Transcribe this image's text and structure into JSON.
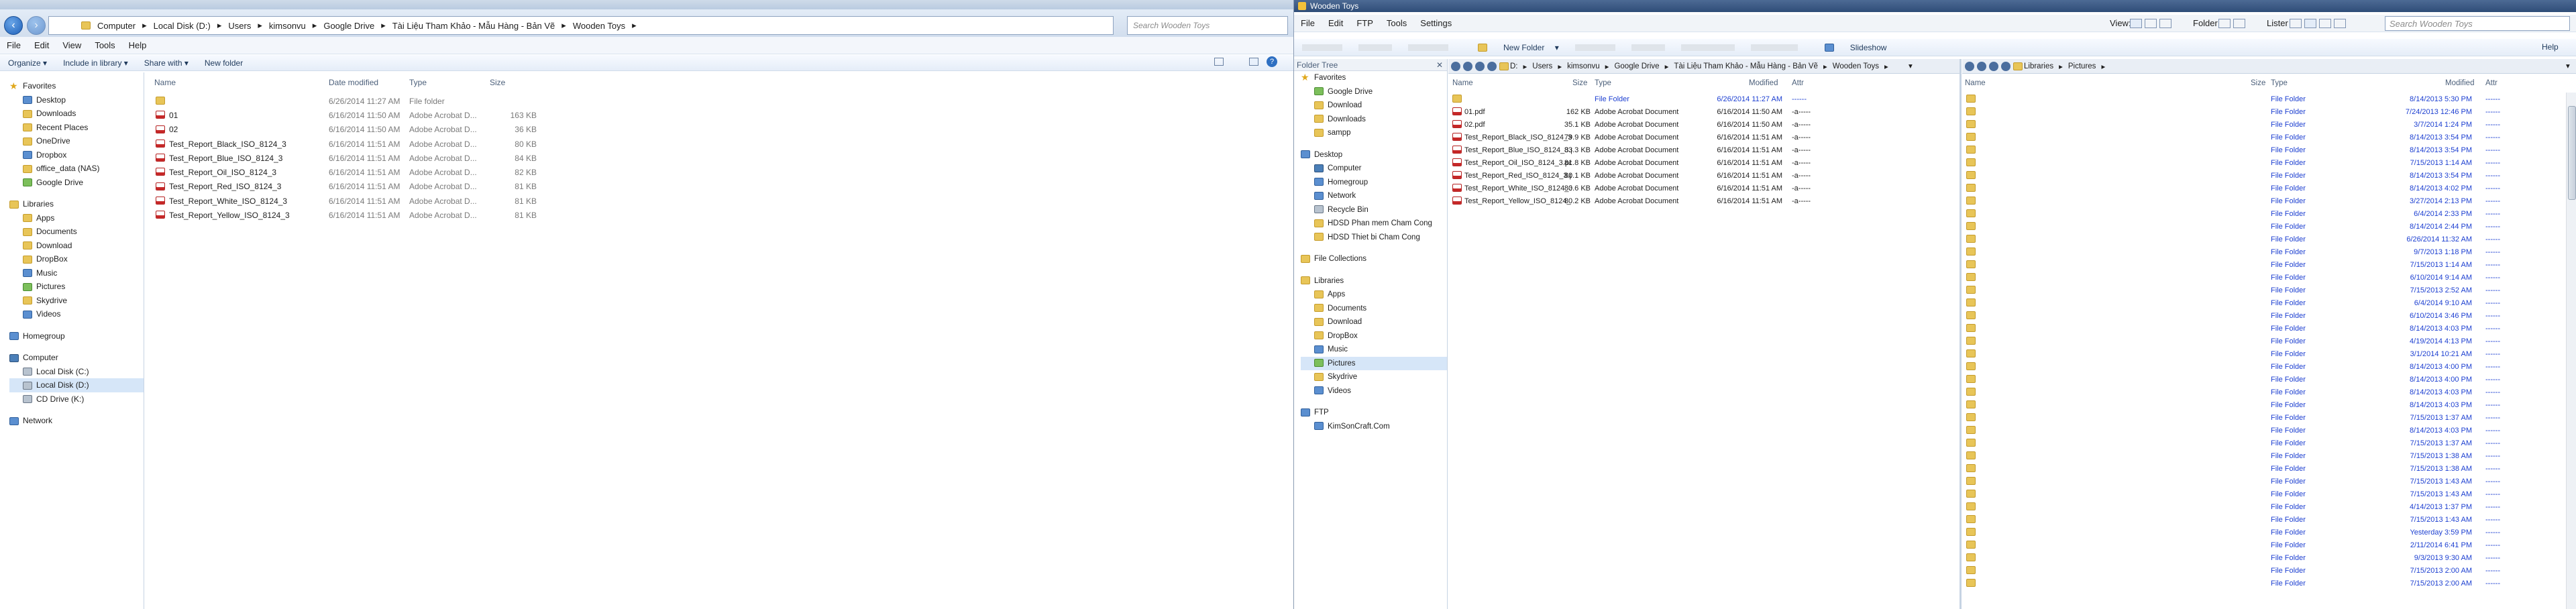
{
  "explorer": {
    "address": [
      "Computer",
      "Local Disk (D:)",
      "Users",
      "kimsonvu",
      "Google Drive",
      "Tài Liệu Tham Khảo - Mẫu Hàng - Bản Vẽ",
      "Wooden Toys"
    ],
    "search_placeholder": "Search Wooden Toys",
    "menu": [
      "File",
      "Edit",
      "View",
      "Tools",
      "Help"
    ],
    "commands": [
      "Organize ▾",
      "Include in library ▾",
      "Share with ▾",
      "New folder"
    ],
    "nav": {
      "favorites_label": "Favorites",
      "favorites": [
        "Desktop",
        "Downloads",
        "Recent Places",
        "OneDrive",
        "Dropbox",
        "office_data (NAS)",
        "Google Drive"
      ],
      "libraries_label": "Libraries",
      "libraries": [
        "Apps",
        "Documents",
        "Download",
        "DropBox",
        "Music",
        "Pictures",
        "Skydrive",
        "Videos"
      ],
      "homegroup": "Homegroup",
      "computer_label": "Computer",
      "drives": [
        "Local Disk (C:)",
        "Local Disk (D:)",
        "CD Drive (K:)"
      ],
      "network": "Network"
    },
    "columns": [
      "Name",
      "Date modified",
      "Type",
      "Size"
    ],
    "files": [
      {
        "name": "",
        "date": "6/26/2014 11:27 AM",
        "type": "File folder",
        "size": ""
      },
      {
        "name": "01",
        "date": "6/16/2014 11:50 AM",
        "type": "Adobe Acrobat D...",
        "size": "163 KB"
      },
      {
        "name": "02",
        "date": "6/16/2014 11:50 AM",
        "type": "Adobe Acrobat D...",
        "size": "36 KB"
      },
      {
        "name": "Test_Report_Black_ISO_8124_3",
        "date": "6/16/2014 11:51 AM",
        "type": "Adobe Acrobat D...",
        "size": "80 KB"
      },
      {
        "name": "Test_Report_Blue_ISO_8124_3",
        "date": "6/16/2014 11:51 AM",
        "type": "Adobe Acrobat D...",
        "size": "84 KB"
      },
      {
        "name": "Test_Report_Oil_ISO_8124_3",
        "date": "6/16/2014 11:51 AM",
        "type": "Adobe Acrobat D...",
        "size": "82 KB"
      },
      {
        "name": "Test_Report_Red_ISO_8124_3",
        "date": "6/16/2014 11:51 AM",
        "type": "Adobe Acrobat D...",
        "size": "81 KB"
      },
      {
        "name": "Test_Report_White_ISO_8124_3",
        "date": "6/16/2014 11:51 AM",
        "type": "Adobe Acrobat D...",
        "size": "81 KB"
      },
      {
        "name": "Test_Report_Yellow_ISO_8124_3",
        "date": "6/16/2014 11:51 AM",
        "type": "Adobe Acrobat D...",
        "size": "81 KB"
      }
    ]
  },
  "xplorer": {
    "title": "Wooden Toys",
    "menu": [
      "File",
      "Edit",
      "FTP",
      "Tools",
      "Settings"
    ],
    "toolbar": {
      "view": "View:",
      "folder": "Folder",
      "lister": "Lister",
      "new_folder": "New Folder",
      "slideshow": "Slideshow",
      "search": "Search Wooden Toys",
      "help": "Help"
    },
    "folder_tree_label": "Folder Tree",
    "tree": {
      "favorites_label": "Favorites",
      "favorites": [
        "Google Drive",
        "Download",
        "Downloads",
        "sampp"
      ],
      "desktop_label": "Desktop",
      "desktop": [
        "Computer",
        "Homegroup",
        "Network",
        "Recycle Bin",
        "HDSD Phan mem Cham Cong",
        "HDSD Thiet bi Cham Cong"
      ],
      "file_collections": "File Collections",
      "libraries_label": "Libraries",
      "libraries": [
        "Apps",
        "Documents",
        "Download",
        "DropBox",
        "Music",
        "Pictures",
        "Skydrive",
        "Videos"
      ],
      "ftp_label": "FTP",
      "ftp": [
        "KimSonCraft.Com"
      ]
    },
    "left_pane": {
      "address": [
        "D:",
        "Users",
        "kimsonvu",
        "Google Drive",
        "Tài Liệu Tham Khảo - Mẫu Hàng - Bản Vẽ",
        "Wooden Toys"
      ],
      "columns": [
        "Name",
        "Size",
        "Type",
        "Modified",
        "Attr"
      ],
      "files": [
        {
          "name": "",
          "size": "",
          "type": "File Folder",
          "modified": "6/26/2014  11:27 AM",
          "attr": "------",
          "folder": true
        },
        {
          "name": "01.pdf",
          "size": "162 KB",
          "type": "Adobe Acrobat Document",
          "modified": "6/16/2014  11:50 AM",
          "attr": "-a-----"
        },
        {
          "name": "02.pdf",
          "size": "35.1 KB",
          "type": "Adobe Acrobat Document",
          "modified": "6/16/2014  11:50 AM",
          "attr": "-a-----"
        },
        {
          "name": "Test_Report_Black_ISO_8124_3.pdf",
          "size": "79.9 KB",
          "type": "Adobe Acrobat Document",
          "modified": "6/16/2014  11:51 AM",
          "attr": "-a-----"
        },
        {
          "name": "Test_Report_Blue_ISO_8124_3.pdf",
          "size": "83.3 KB",
          "type": "Adobe Acrobat Document",
          "modified": "6/16/2014  11:51 AM",
          "attr": "-a-----"
        },
        {
          "name": "Test_Report_Oil_ISO_8124_3.pdf",
          "size": "81.8 KB",
          "type": "Adobe Acrobat Document",
          "modified": "6/16/2014  11:51 AM",
          "attr": "-a-----"
        },
        {
          "name": "Test_Report_Red_ISO_8124_3.pdf",
          "size": "80.1 KB",
          "type": "Adobe Acrobat Document",
          "modified": "6/16/2014  11:51 AM",
          "attr": "-a-----"
        },
        {
          "name": "Test_Report_White_ISO_8124_3.pdf",
          "size": "80.6 KB",
          "type": "Adobe Acrobat Document",
          "modified": "6/16/2014  11:51 AM",
          "attr": "-a-----"
        },
        {
          "name": "Test_Report_Yellow_ISO_8124_3.pdf",
          "size": "80.2 KB",
          "type": "Adobe Acrobat Document",
          "modified": "6/16/2014  11:51 AM",
          "attr": "-a-----"
        }
      ]
    },
    "right_pane": {
      "address": [
        "Libraries",
        "Pictures"
      ],
      "columns": [
        "Name",
        "Size",
        "Type",
        "Modified",
        "Attr"
      ],
      "type_label": "File Folder",
      "attr": "------",
      "modified": [
        "8/14/2013  5:30 PM",
        "7/24/2013  12:46 PM",
        "3/7/2014  1:24 PM",
        "8/14/2013  3:54 PM",
        "8/14/2013  3:54 PM",
        "7/15/2013  1:14 AM",
        "8/14/2013  3:54 PM",
        "8/14/2013  4:02 PM",
        "3/27/2014  2:13 PM",
        "6/4/2014  2:33 PM",
        "8/14/2014  2:44 PM",
        "6/26/2014  11:32 AM",
        "9/7/2013  1:18 PM",
        "7/15/2013  1:14 AM",
        "6/10/2014  9:14 AM",
        "7/15/2013  2:52 AM",
        "6/4/2014  9:10 AM",
        "6/10/2014  3:46 PM",
        "8/14/2013  4:03 PM",
        "4/19/2014  4:13 PM",
        "3/1/2014  10:21 AM",
        "8/14/2013  4:00 PM",
        "8/14/2013  4:00 PM",
        "8/14/2013  4:03 PM",
        "8/14/2013  4:03 PM",
        "7/15/2013  1:37 AM",
        "8/14/2013  4:03 PM",
        "7/15/2013  1:37 AM",
        "7/15/2013  1:38 AM",
        "7/15/2013  1:38 AM",
        "7/15/2013  1:43 AM",
        "7/15/2013  1:43 AM",
        "4/14/2013  1:37 PM",
        "7/15/2013  1:43 AM",
        "Yesterday  3:59 PM",
        "2/11/2014  6:41 PM",
        "9/3/2013  9:30 AM",
        "7/15/2013  2:00 AM",
        "7/15/2013  2:00 AM"
      ]
    }
  }
}
